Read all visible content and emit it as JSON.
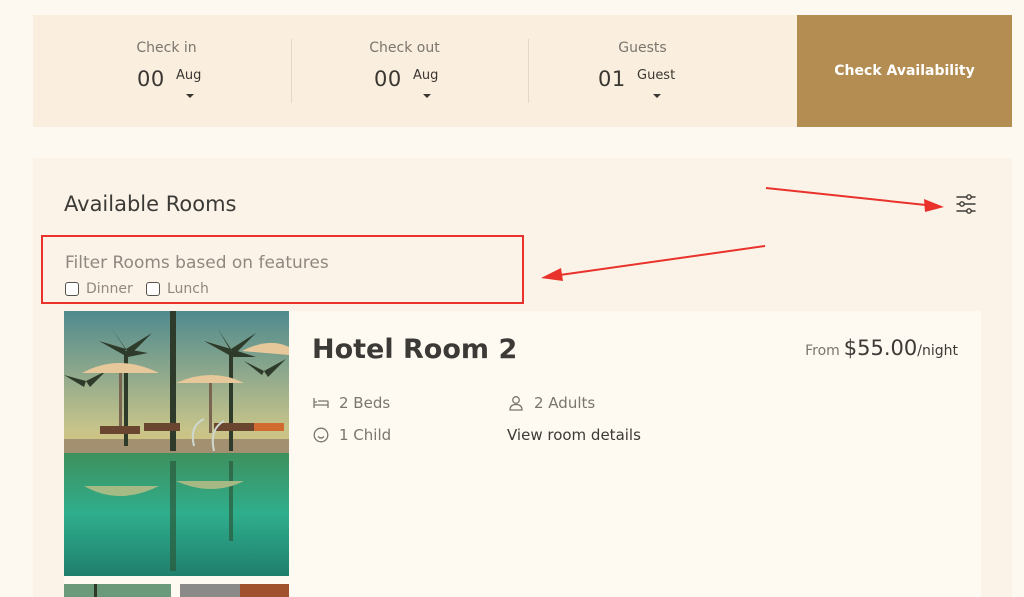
{
  "booking": {
    "check_in": {
      "label": "Check in",
      "day": "00",
      "month": "Aug"
    },
    "check_out": {
      "label": "Check out",
      "day": "00",
      "month": "Aug"
    },
    "guests": {
      "label": "Guests",
      "count": "01",
      "unit": "Guest"
    },
    "check_button": "Check Availability"
  },
  "rooms": {
    "title": "Available Rooms",
    "filter_icon": "sliders-icon",
    "filter": {
      "title": "Filter Rooms based on features",
      "options": [
        {
          "label": "Dinner",
          "checked": false
        },
        {
          "label": "Lunch",
          "checked": false
        }
      ]
    },
    "list": [
      {
        "name": "Hotel Room 2",
        "price_prefix": "From",
        "price": "$55.00",
        "price_unit": "/night",
        "beds": "2 Beds",
        "adults": "2 Adults",
        "children": "1 Child",
        "details_link": "View room details",
        "photo": "resort-pool-palm-trees-sunset"
      }
    ]
  },
  "colors": {
    "accent": "#b48d52",
    "bar_bg": "#faefdf",
    "panel_bg": "#fbf3e7",
    "annotation": "#e8322b"
  }
}
